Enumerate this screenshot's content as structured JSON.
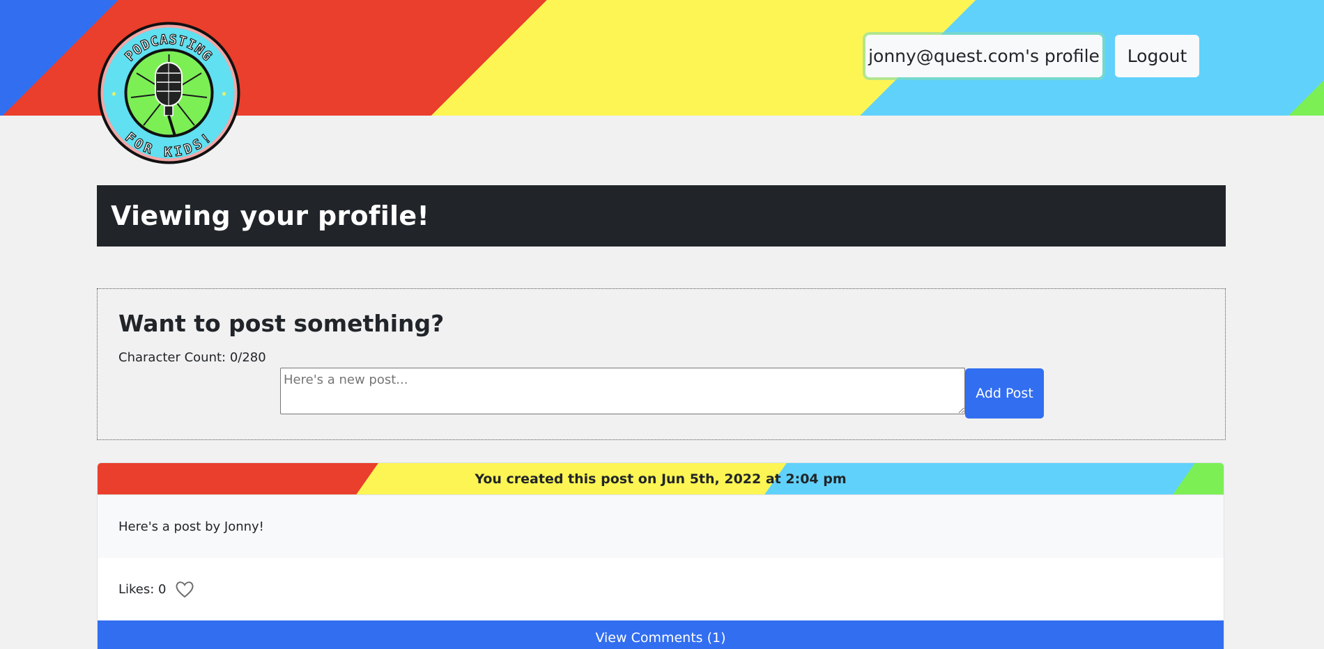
{
  "header": {
    "logo": {
      "icon": "microphone-icon",
      "top_text": "PODCASTING",
      "bottom_text": "FOR KIDS!"
    },
    "profile_button": "jonny@quest.com's profile",
    "logout_button": "Logout",
    "stripe_colors": [
      "#326ef0",
      "#ea3f2c",
      "#fdf553",
      "#60d1fb",
      "#7cef55"
    ]
  },
  "page": {
    "title": "Viewing your profile!"
  },
  "new_post": {
    "heading": "Want to post something?",
    "char_count": "Character Count: 0/280",
    "placeholder": "Here's a new post...",
    "value": "",
    "add_button": "Add Post"
  },
  "posts": [
    {
      "header": "You created this post on Jun 5th, 2022 at 2:04 pm",
      "body": "Here's a post by Jonny!",
      "likes_text": "Likes: 0",
      "like_icon": "heart-outline-icon",
      "comments_button": "View Comments (1)"
    }
  ],
  "colors": {
    "accent": "#326ef0",
    "dark": "#212529",
    "background": "#f1f1f1"
  }
}
